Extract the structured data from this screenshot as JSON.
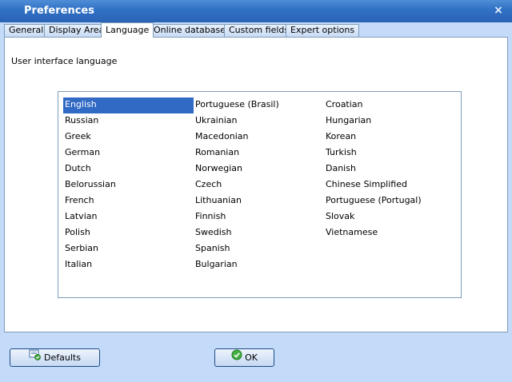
{
  "window": {
    "title": "Preferences"
  },
  "tabs": [
    {
      "label": "General"
    },
    {
      "label": "Display Area"
    },
    {
      "label": "Language"
    },
    {
      "label": "Online databases"
    },
    {
      "label": "Custom fields"
    },
    {
      "label": "Expert options"
    }
  ],
  "active_tab": "Language",
  "language_section": {
    "label": "User interface language",
    "selected": "English",
    "columns": [
      [
        "English",
        "Russian",
        "Greek",
        "German",
        "Dutch",
        "Belorussian",
        "French",
        "Latvian",
        "Polish",
        "Serbian",
        "Italian"
      ],
      [
        "Portuguese (Brasil)",
        "Ukrainian",
        "Macedonian",
        "Romanian",
        "Norwegian",
        "Czech",
        "Lithuanian",
        "Finnish",
        "Swedish",
        "Spanish",
        "Bulgarian"
      ],
      [
        "Croatian",
        "Hungarian",
        "Korean",
        "Turkish",
        "Danish",
        "Chinese Simplified",
        "Portuguese (Portugal)",
        "Slovak",
        "Vietnamese"
      ]
    ]
  },
  "buttons": {
    "defaults": "Defaults",
    "ok": "OK"
  },
  "colors": {
    "title_bar": "#3172c6",
    "selection": "#316ac5",
    "frame": "#c3daf9"
  }
}
